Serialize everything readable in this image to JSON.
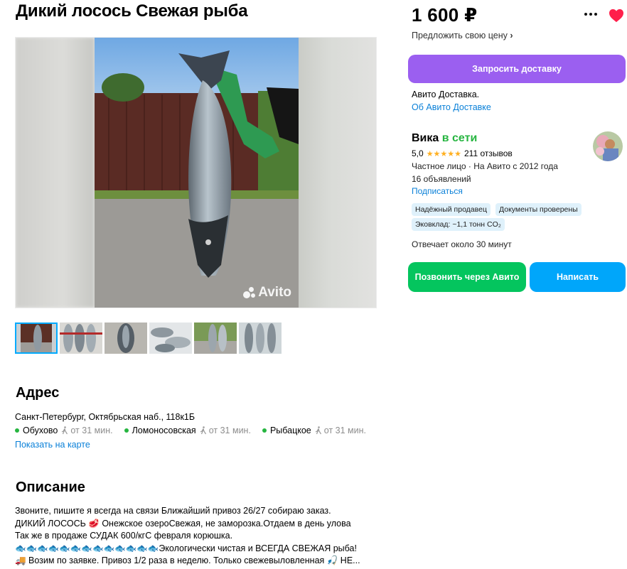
{
  "listing": {
    "title": "Дикий лосось Свежая рыба",
    "watermark": "Avito"
  },
  "address": {
    "heading": "Адрес",
    "full": "Санкт-Петербург, Октябрьская наб., 118к1Б",
    "metro": [
      {
        "station": "Обухово",
        "time": "от 31 мин."
      },
      {
        "station": "Ломоносовская",
        "time": "от 31 мин."
      },
      {
        "station": "Рыбацкое",
        "time": "от 31 мин."
      }
    ],
    "metro_color": "#26b540",
    "map_link": "Показать на карте"
  },
  "description": {
    "heading": "Описание",
    "lines": [
      "Звоните, пишите я всегда на связи Ближайший привоз 26/27 собираю заказ.",
      "ДИКИЙ ЛОСОСЬ 🥩 Онежское озероСвежая, не заморозка.Отдаем в день улова",
      "Так же в продаже СУДАК 600/кгС февраля корюшка.",
      "🐟🐟🐟🐟🐟🐟🐟🐟🐟🐟🐟🐟🐟Экологически чистая и ВСЕГДА СВЕЖАЯ рыба!",
      "🚚 Возим по заявке. Привоз 1/2 раза в неделю. Только свежевыловленная 🎣 НЕ..."
    ]
  },
  "sidebar": {
    "price": "1 600 ₽",
    "offer_price": "Предложить свою цену",
    "delivery_button": "Запросить доставку",
    "delivery_text": "Авито Доставка.",
    "delivery_link": "Об Авито Доставке",
    "seller": {
      "name": "Вика",
      "status": "в сети",
      "rating": "5,0",
      "stars": "★★★★★",
      "reviews": "211 отзывов",
      "type": "Частное лицо · На Авито с 2012 года",
      "ads": "16 объявлений",
      "subscribe": "Подписаться",
      "badges": [
        "Надёжный продавец",
        "Документы проверены",
        "Эковклад: ~1,1 тонн CO₂"
      ],
      "reply_time": "Отвечает около 30 минут"
    },
    "call_button": "Позвонить через Авито",
    "write_button": "Написать"
  },
  "colors": {
    "accent_purple": "#9b5ff0",
    "call_green": "#04c55e",
    "write_blue": "#00a6fa",
    "link_blue": "#0a80d8",
    "favorite_red": "#ff1f4b"
  },
  "icons": [
    "more-dots-icon",
    "heart-icon",
    "chevron-right-icon",
    "walk-icon",
    "avito-logo-icon"
  ]
}
